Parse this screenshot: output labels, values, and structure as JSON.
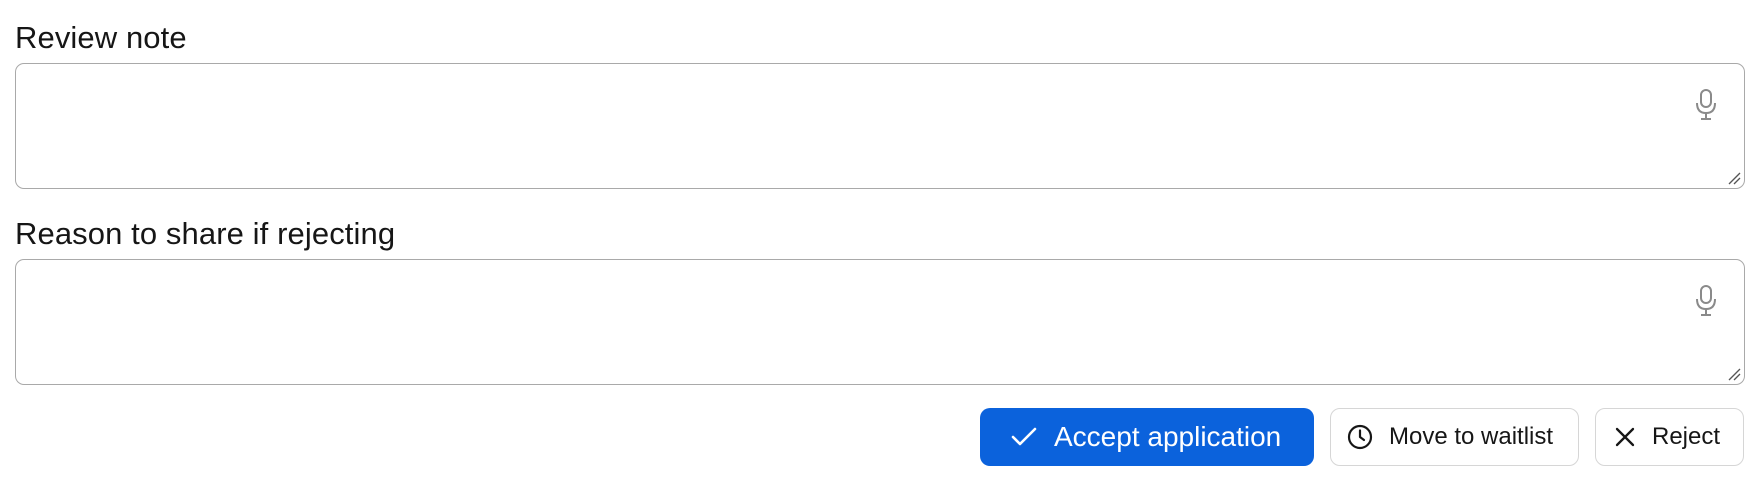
{
  "form": {
    "review_note": {
      "label": "Review note",
      "value": "",
      "icon": "microphone-icon"
    },
    "rejection_reason": {
      "label": "Reason to share if rejecting",
      "value": "",
      "icon": "microphone-icon"
    }
  },
  "actions": {
    "accept": {
      "label": "Accept application",
      "icon": "check-icon",
      "color": "#0b62dc"
    },
    "waitlist": {
      "label": "Move to waitlist",
      "icon": "clock-icon"
    },
    "reject": {
      "label": "Reject",
      "icon": "close-icon"
    }
  }
}
